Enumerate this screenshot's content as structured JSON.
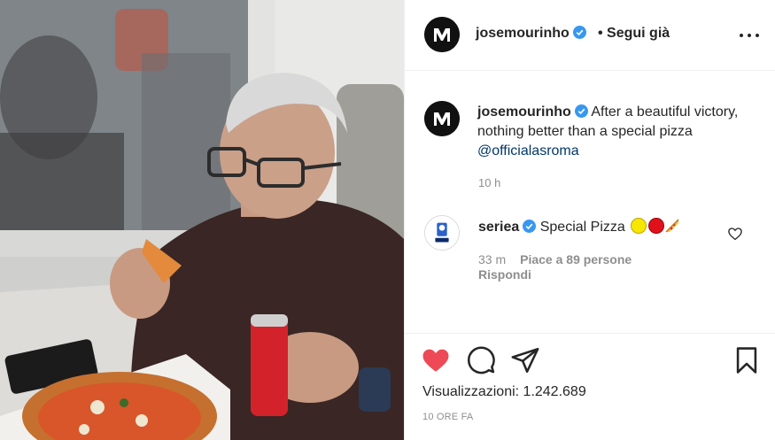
{
  "header": {
    "username": "josemourinho",
    "follow_status": "• Segui già"
  },
  "caption": {
    "username": "josemourinho",
    "text": "After a beautiful victory, nothing better than a special pizza ",
    "mention": "@officialasroma",
    "time": "10 h"
  },
  "comment": {
    "username": "seriea",
    "text": "Special Pizza",
    "emojis": [
      "yellow-circle-emoji",
      "red-circle-emoji",
      "pizza-emoji"
    ],
    "time": "33 m",
    "likes": "Piace a 89 persone",
    "reply_label": "Rispondi"
  },
  "actions": {
    "liked": true,
    "like_color": "#ed4956"
  },
  "views": "Visualizzazioni: 1.242.689",
  "posted_ago": "10 ORE FA",
  "colors": {
    "text": "#262626",
    "secondary": "#8e8e8e",
    "link": "#00376b",
    "verified": "#3897f0",
    "border": "#efefef"
  },
  "media": {
    "icons": [
      "video-frame"
    ]
  }
}
